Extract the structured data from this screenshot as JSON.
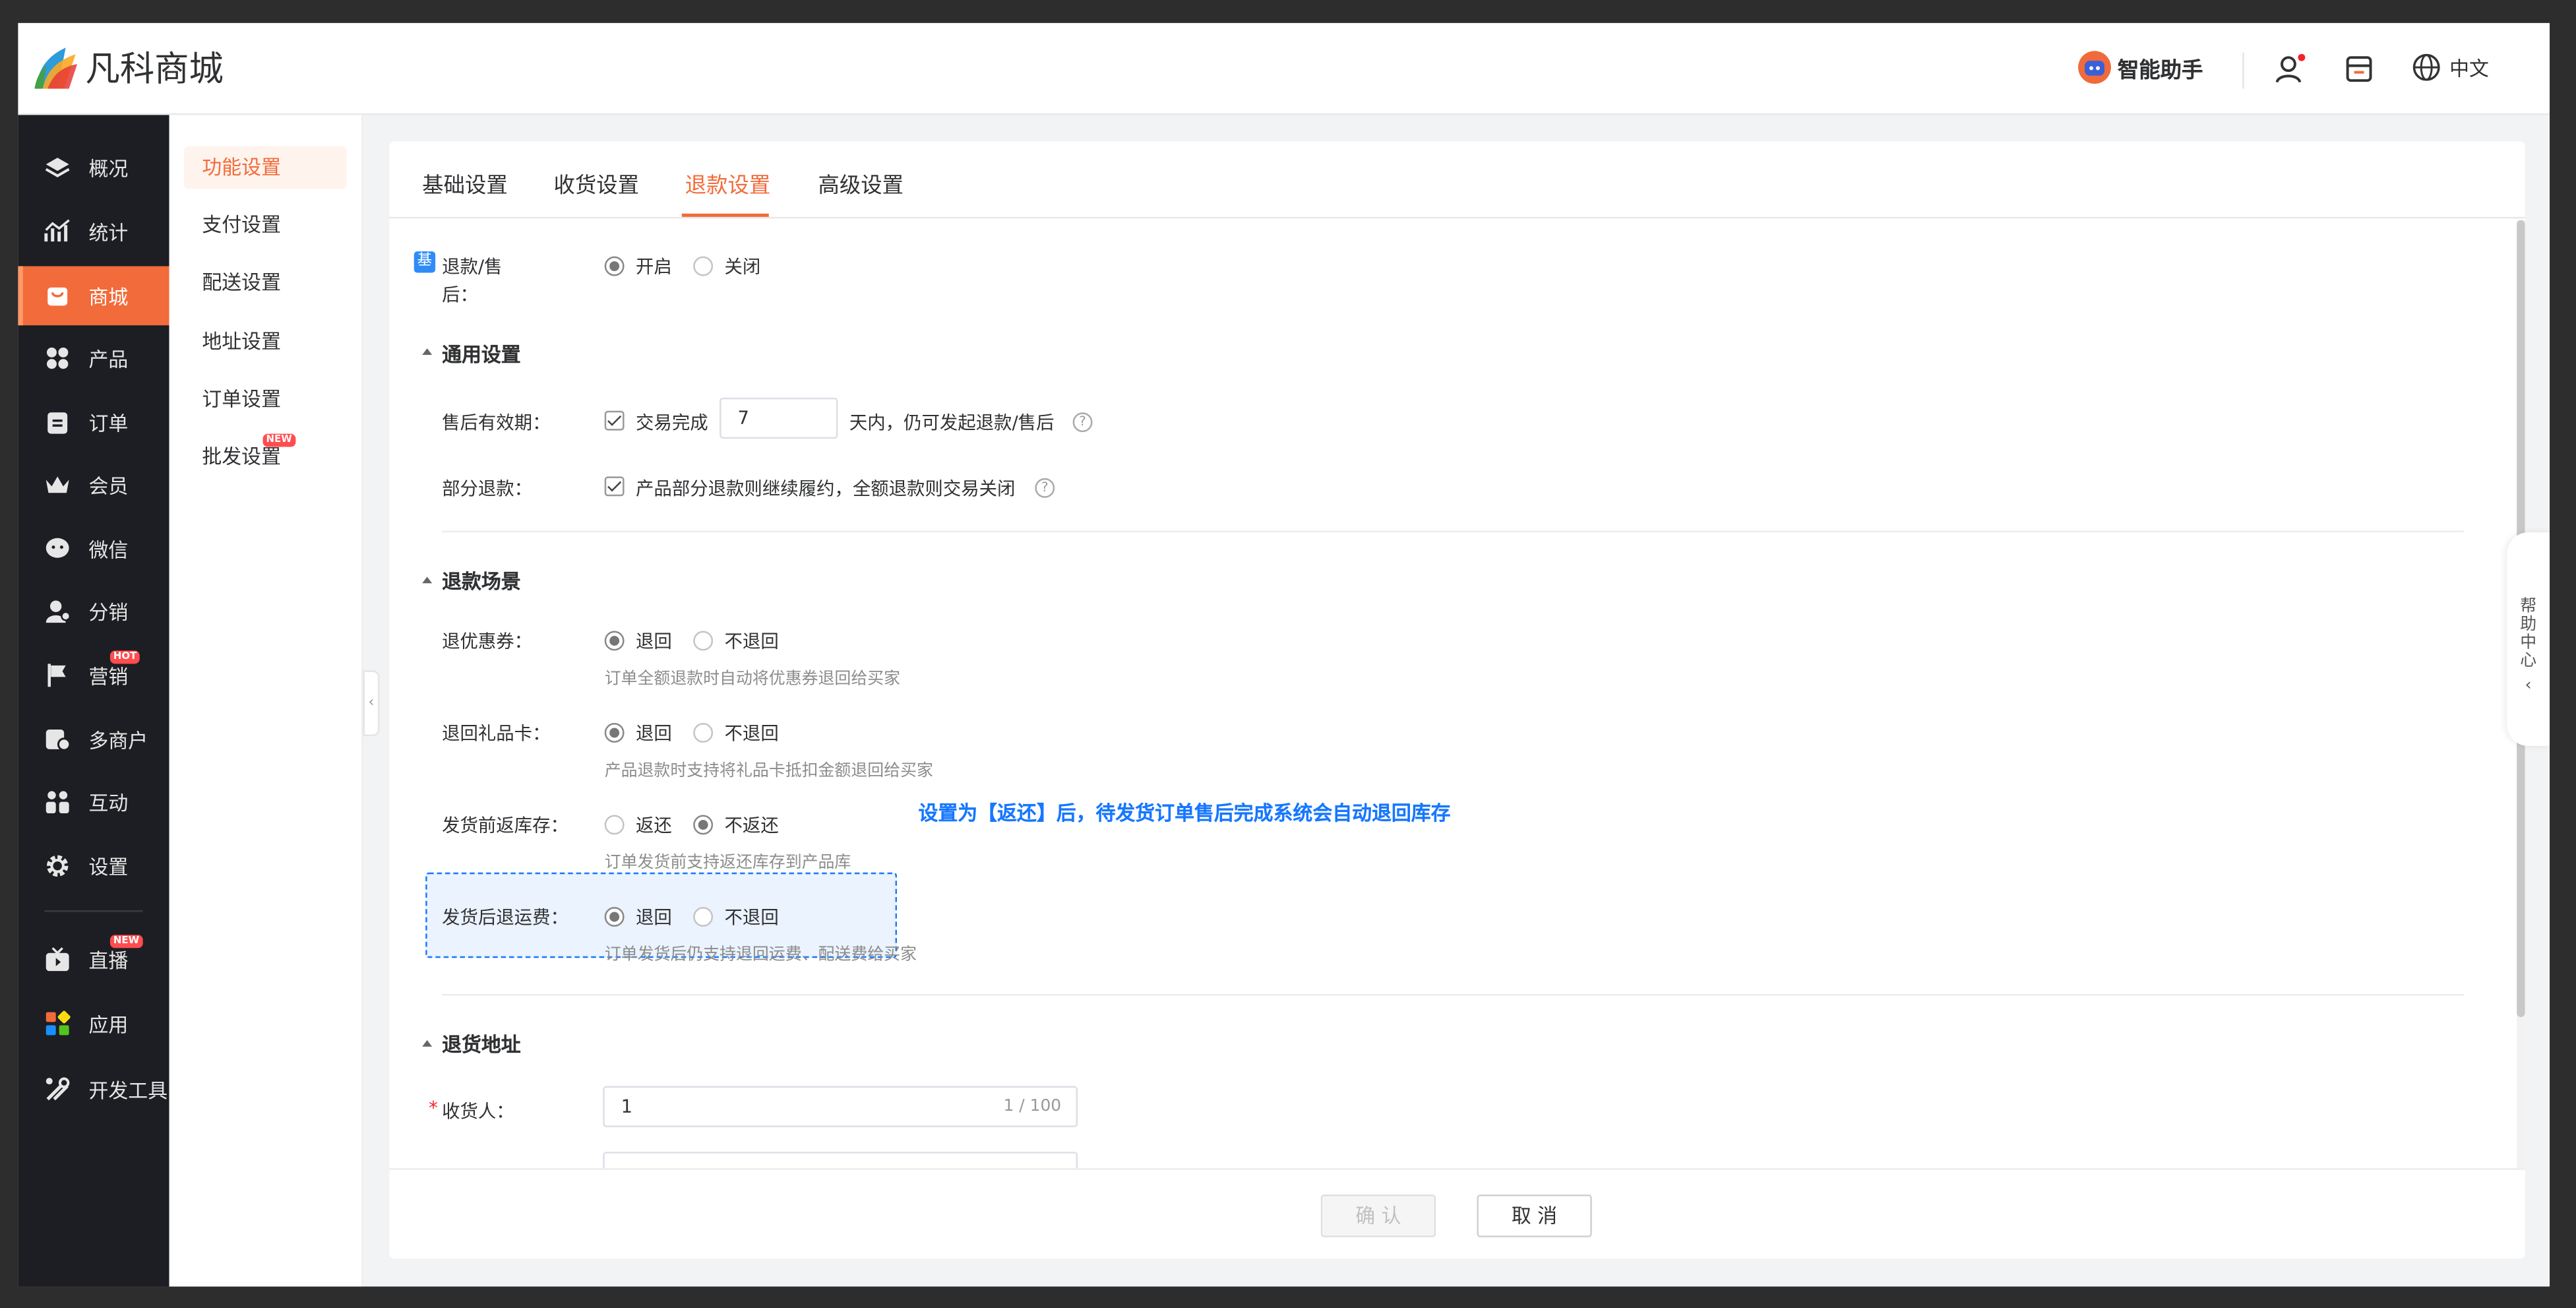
{
  "brand": {
    "name": "凡科商城"
  },
  "header": {
    "ai_assistant": "智能助手",
    "language": "中文"
  },
  "nav_primary": [
    {
      "label": "概况",
      "icon": "layers-icon"
    },
    {
      "label": "统计",
      "icon": "chart-icon"
    },
    {
      "label": "商城",
      "icon": "shop-icon",
      "active": true
    },
    {
      "label": "产品",
      "icon": "product-icon"
    },
    {
      "label": "订单",
      "icon": "order-icon"
    },
    {
      "label": "会员",
      "icon": "crown-icon"
    },
    {
      "label": "微信",
      "icon": "wechat-icon"
    },
    {
      "label": "分销",
      "icon": "distribution-icon"
    },
    {
      "label": "营销",
      "icon": "flag-icon",
      "badge": "HOT"
    },
    {
      "label": "多商户",
      "icon": "merchant-icon"
    },
    {
      "label": "互动",
      "icon": "interact-icon"
    },
    {
      "label": "设置",
      "icon": "gear-icon"
    },
    {
      "label": "直播",
      "icon": "live-icon",
      "badge": "NEW"
    },
    {
      "label": "应用",
      "icon": "apps-icon"
    },
    {
      "label": "开发工具",
      "icon": "tools-icon"
    }
  ],
  "nav_secondary": [
    {
      "label": "功能设置",
      "active": true
    },
    {
      "label": "支付设置"
    },
    {
      "label": "配送设置"
    },
    {
      "label": "地址设置"
    },
    {
      "label": "订单设置"
    },
    {
      "label": "批发设置",
      "badge": "NEW"
    }
  ],
  "tabs": [
    "基础设置",
    "收货设置",
    "退款设置",
    "高级设置"
  ],
  "active_tab": "退款设置",
  "form": {
    "refund_tag": "基",
    "refund_label_1": "退款/售",
    "refund_label_2": "后：",
    "refund_on": "开启",
    "refund_off": "关闭",
    "sec_general": "通用设置",
    "validity_label": "售后有效期：",
    "validity_check": "交易完成",
    "validity_days": "7",
    "validity_suffix": "天内，仍可发起退款/售后",
    "partial_label": "部分退款：",
    "partial_check": "产品部分退款则继续履约，全额退款则交易关闭",
    "sec_scene": "退款场景",
    "coupon_label": "退优惠券：",
    "coupon_yes": "退回",
    "coupon_no": "不退回",
    "coupon_hint": "订单全额退款时自动将优惠券退回给买家",
    "gift_label": "退回礼品卡：",
    "gift_yes": "退回",
    "gift_no": "不退回",
    "gift_hint": "产品退款时支持将礼品卡抵扣金额退回给买家",
    "stock_label": "发货前返库存：",
    "stock_yes": "返还",
    "stock_no": "不返还",
    "stock_hint": "订单发货前支持返还库存到产品库",
    "stock_note": "设置为【返还】后，待发货订单售后完成系统会自动退回库存",
    "freight_label": "发货后退运费：",
    "freight_yes": "退回",
    "freight_no": "不退回",
    "freight_hint": "订单发货后仍支持退回运费、配送费给买家",
    "sec_address": "退货地址",
    "receiver_required": "*",
    "receiver_label": "收货人：",
    "receiver_value": "1",
    "receiver_count": "1 / 100"
  },
  "footer": {
    "confirm": "确 认",
    "cancel": "取 消"
  },
  "help_center": "帮助中心",
  "colors": {
    "accent": "#f26b3a",
    "sidebar": "#1d1e23",
    "highlight": "#1677ff"
  }
}
